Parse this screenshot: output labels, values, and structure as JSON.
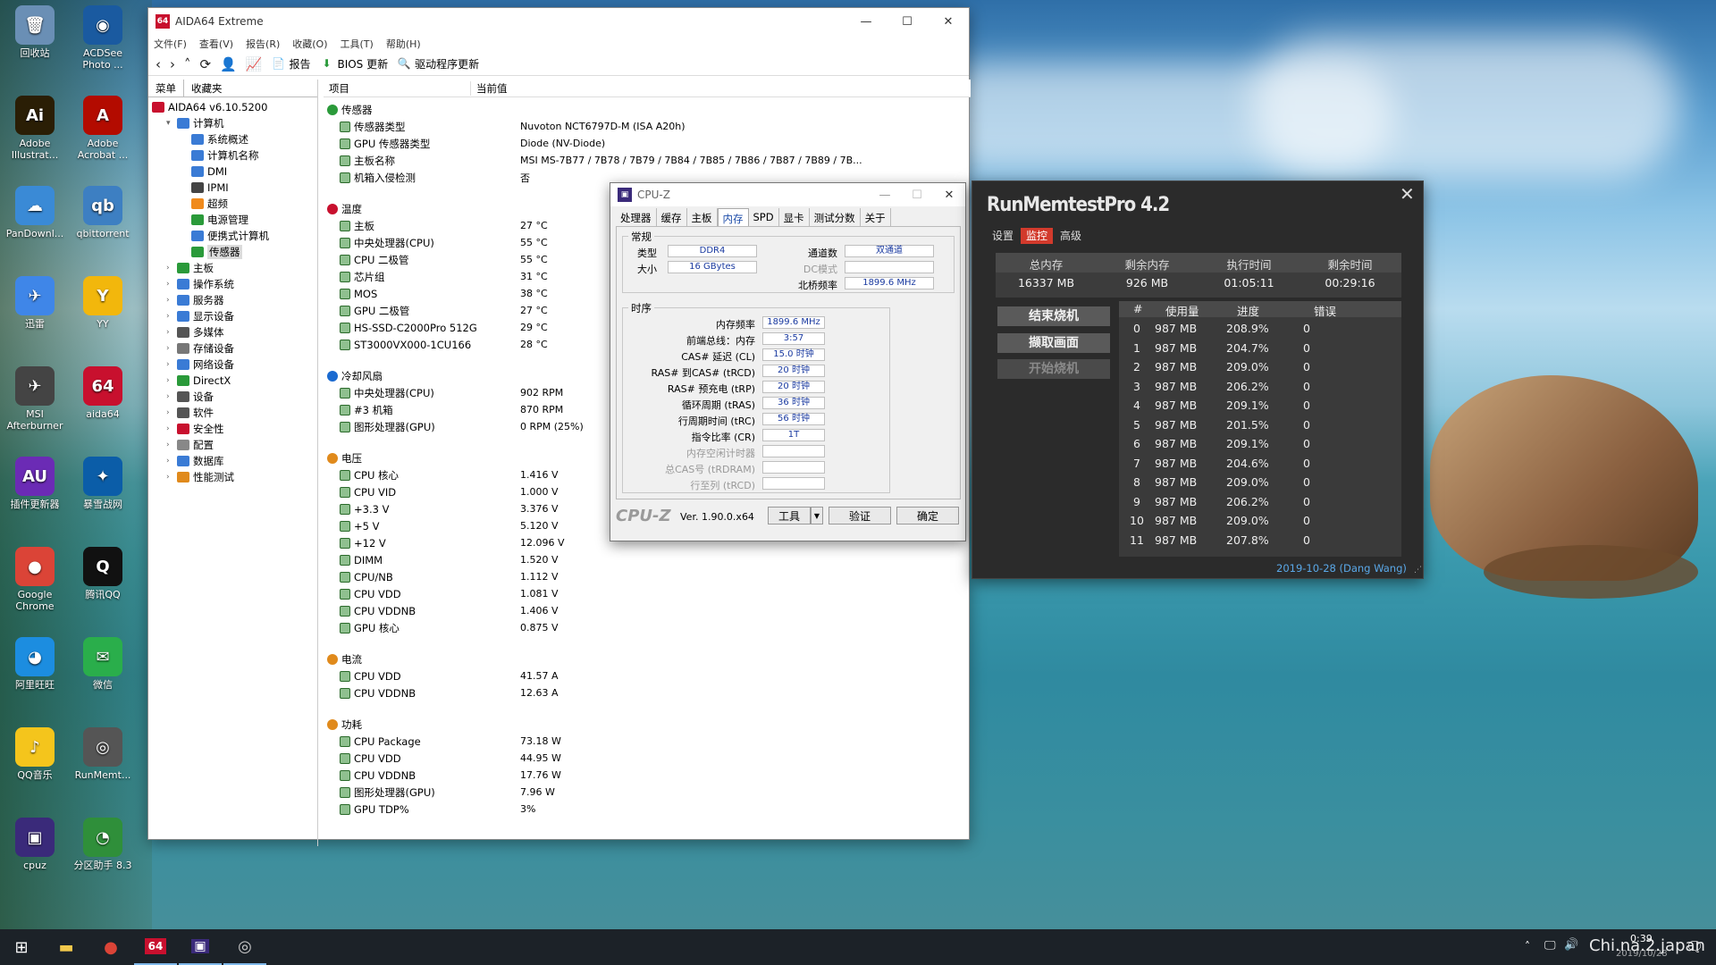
{
  "desktop": {
    "icons": [
      {
        "label": "回收站",
        "glyph": "🗑",
        "color": "#6a8fb5"
      },
      {
        "label": "ACDSee Photo ...",
        "glyph": "◉",
        "color": "#1a5aa0"
      },
      {
        "label": "Adobe Illustrat...",
        "glyph": "Ai",
        "color": "#2a1e05"
      },
      {
        "label": "Adobe Acrobat ...",
        "glyph": "A",
        "color": "#b30b00"
      },
      {
        "label": "PanDownl...",
        "glyph": "☁",
        "color": "#3a8ad6"
      },
      {
        "label": "qbittorrent",
        "glyph": "qb",
        "color": "#3d7fc2"
      },
      {
        "label": "迅雷",
        "glyph": "✈",
        "color": "#3f86e8"
      },
      {
        "label": "YY",
        "glyph": "Y",
        "color": "#f2b70c"
      },
      {
        "label": "MSI Afterburner",
        "glyph": "✈",
        "color": "#444"
      },
      {
        "label": "aida64",
        "glyph": "64",
        "color": "#c8102e"
      },
      {
        "label": "插件更新器",
        "glyph": "AU",
        "color": "#6b2bb5"
      },
      {
        "label": "暴雪战网",
        "glyph": "✦",
        "color": "#0b5da8"
      },
      {
        "label": "Google Chrome",
        "glyph": "●",
        "color": "#db4437"
      },
      {
        "label": "腾讯QQ",
        "glyph": "Q",
        "color": "#111"
      },
      {
        "label": "阿里旺旺",
        "glyph": "◕",
        "color": "#1c8de0"
      },
      {
        "label": "微信",
        "glyph": "✉",
        "color": "#2aae4b"
      },
      {
        "label": "QQ音乐",
        "glyph": "♪",
        "color": "#f4c51c"
      },
      {
        "label": "RunMemt...",
        "glyph": "◎",
        "color": "#555"
      },
      {
        "label": "cpuz",
        "glyph": "▣",
        "color": "#3a2a7a"
      },
      {
        "label": "分区助手 8.3",
        "glyph": "◔",
        "color": "#2f8f3a"
      }
    ]
  },
  "taskbar": {
    "clock_time": "0:39",
    "clock_date": "2019/10/28",
    "watermark": "Chi.na.2.japan"
  },
  "aida": {
    "title": "AIDA64 Extreme",
    "menus": [
      "文件(F)",
      "查看(V)",
      "报告(R)",
      "收藏(O)",
      "工具(T)",
      "帮助(H)"
    ],
    "toolbar": {
      "report": "报告",
      "bios": "BIOS 更新",
      "driver": "驱动程序更新"
    },
    "left_tabs": [
      "菜单",
      "收藏夹"
    ],
    "tree": [
      {
        "label": "AIDA64 v6.10.5200",
        "indent": 0,
        "color": "#c8102e"
      },
      {
        "label": "计算机",
        "indent": 1,
        "color": "#3a7bd5"
      },
      {
        "label": "系统概述",
        "indent": 2,
        "color": "#3a7bd5"
      },
      {
        "label": "计算机名称",
        "indent": 2,
        "color": "#3a7bd5"
      },
      {
        "label": "DMI",
        "indent": 2,
        "color": "#3a7bd5"
      },
      {
        "label": "IPMI",
        "indent": 2,
        "color": "#444"
      },
      {
        "label": "超频",
        "indent": 2,
        "color": "#f08a1c"
      },
      {
        "label": "电源管理",
        "indent": 2,
        "color": "#2a9a3a"
      },
      {
        "label": "便携式计算机",
        "indent": 2,
        "color": "#3a7bd5"
      },
      {
        "label": "传感器",
        "indent": 2,
        "color": "#2a9a3a",
        "selected": true
      },
      {
        "label": "主板",
        "indent": 1,
        "color": "#2a9a3a"
      },
      {
        "label": "操作系统",
        "indent": 1,
        "color": "#3a7bd5"
      },
      {
        "label": "服务器",
        "indent": 1,
        "color": "#3a7bd5"
      },
      {
        "label": "显示设备",
        "indent": 1,
        "color": "#3a7bd5"
      },
      {
        "label": "多媒体",
        "indent": 1,
        "color": "#555"
      },
      {
        "label": "存储设备",
        "indent": 1,
        "color": "#777"
      },
      {
        "label": "网络设备",
        "indent": 1,
        "color": "#3a7bd5"
      },
      {
        "label": "DirectX",
        "indent": 1,
        "color": "#2a9a3a"
      },
      {
        "label": "设备",
        "indent": 1,
        "color": "#555"
      },
      {
        "label": "软件",
        "indent": 1,
        "color": "#555"
      },
      {
        "label": "安全性",
        "indent": 1,
        "color": "#c8102e"
      },
      {
        "label": "配置",
        "indent": 1,
        "color": "#888"
      },
      {
        "label": "数据库",
        "indent": 1,
        "color": "#3a7bd5"
      },
      {
        "label": "性能测试",
        "indent": 1,
        "color": "#e08a1c"
      }
    ],
    "col_item": "项目",
    "col_value": "当前值",
    "sections": [
      {
        "title": "传感器",
        "rows": [
          {
            "k": "传感器类型",
            "v": "Nuvoton NCT6797D-M  (ISA A20h)"
          },
          {
            "k": "GPU 传感器类型",
            "v": "Diode  (NV-Diode)"
          },
          {
            "k": "主板名称",
            "v": "MSI MS-7B77 / 7B78 / 7B79 / 7B84 / 7B85 / 7B86 / 7B87 / 7B89 / 7B..."
          },
          {
            "k": "机箱入侵检测",
            "v": "否"
          }
        ]
      },
      {
        "title": "温度",
        "rows": [
          {
            "k": "主板",
            "v": "27 °C"
          },
          {
            "k": "中央处理器(CPU)",
            "v": "55 °C"
          },
          {
            "k": "CPU 二极管",
            "v": "55 °C"
          },
          {
            "k": "芯片组",
            "v": "31 °C"
          },
          {
            "k": "MOS",
            "v": "38 °C"
          },
          {
            "k": "GPU 二极管",
            "v": "27 °C"
          },
          {
            "k": "HS-SSD-C2000Pro 512G",
            "v": "29 °C"
          },
          {
            "k": "ST3000VX000-1CU166",
            "v": "28 °C"
          }
        ]
      },
      {
        "title": "冷却风扇",
        "rows": [
          {
            "k": "中央处理器(CPU)",
            "v": "902 RPM"
          },
          {
            "k": "#3 机箱",
            "v": "870 RPM"
          },
          {
            "k": "图形处理器(GPU)",
            "v": "0 RPM  (25%)"
          }
        ]
      },
      {
        "title": "电压",
        "rows": [
          {
            "k": "CPU 核心",
            "v": "1.416 V"
          },
          {
            "k": "CPU VID",
            "v": "1.000 V"
          },
          {
            "k": "+3.3 V",
            "v": "3.376 V"
          },
          {
            "k": "+5 V",
            "v": "5.120 V"
          },
          {
            "k": "+12 V",
            "v": "12.096 V"
          },
          {
            "k": "DIMM",
            "v": "1.520 V"
          },
          {
            "k": "CPU/NB",
            "v": "1.112 V"
          },
          {
            "k": "CPU VDD",
            "v": "1.081 V"
          },
          {
            "k": "CPU VDDNB",
            "v": "1.406 V"
          },
          {
            "k": "GPU 核心",
            "v": "0.875 V"
          }
        ]
      },
      {
        "title": "电流",
        "rows": [
          {
            "k": "CPU VDD",
            "v": "41.57 A"
          },
          {
            "k": "CPU VDDNB",
            "v": "12.63 A"
          }
        ]
      },
      {
        "title": "功耗",
        "rows": [
          {
            "k": "CPU Package",
            "v": "73.18 W"
          },
          {
            "k": "CPU VDD",
            "v": "44.95 W"
          },
          {
            "k": "CPU VDDNB",
            "v": "17.76 W"
          },
          {
            "k": "图形处理器(GPU)",
            "v": "7.96 W"
          },
          {
            "k": "GPU TDP%",
            "v": "3%"
          }
        ]
      }
    ]
  },
  "cpuz": {
    "title": "CPU-Z",
    "tabs": [
      "处理器",
      "缓存",
      "主板",
      "内存",
      "SPD",
      "显卡",
      "测试分数",
      "关于"
    ],
    "general_title": "常规",
    "type_label": "类型",
    "type_value": "DDR4",
    "size_label": "大小",
    "size_value": "16 GBytes",
    "channels_label": "通道数",
    "channels_value": "双通道",
    "dc_label": "DC模式",
    "dc_value": "",
    "nb_label": "北桥频率",
    "nb_value": "1899.6 MHz",
    "timing_title": "时序",
    "timings": [
      {
        "label": "内存频率",
        "value": "1899.6 MHz"
      },
      {
        "label": "前端总线：内存",
        "value": "3:57"
      },
      {
        "label": "CAS# 延迟 (CL)",
        "value": "15.0 时钟"
      },
      {
        "label": "RAS# 到CAS# (tRCD)",
        "value": "20 时钟"
      },
      {
        "label": "RAS# 预充电 (tRP)",
        "value": "20 时钟"
      },
      {
        "label": "循环周期 (tRAS)",
        "value": "36 时钟"
      },
      {
        "label": "行周期时间 (tRC)",
        "value": "56 时钟"
      },
      {
        "label": "指令比率 (CR)",
        "value": "1T"
      },
      {
        "label": "内存空闲计时器",
        "value": ""
      },
      {
        "label": "总CAS号 (tRDRAM)",
        "value": ""
      },
      {
        "label": "行至列 (tRCD)",
        "value": ""
      }
    ],
    "logo": "CPU-Z",
    "version": "Ver. 1.90.0.x64",
    "tools_btn": "工具",
    "validate_btn": "验证",
    "ok_btn": "确定"
  },
  "runmemtest": {
    "title": "RunMemtestPro 4.2",
    "tabs": [
      "设置",
      "监控",
      "高级"
    ],
    "stat_headers": [
      "总内存",
      "剩余内存",
      "执行时间",
      "剩余时间"
    ],
    "stat_values": [
      "16337 MB",
      "926 MB",
      "01:05:11",
      "00:29:16"
    ],
    "buttons": [
      "结束烧机",
      "撷取画面",
      "开始烧机"
    ],
    "table_headers": [
      "#",
      "使用量",
      "进度",
      "错误"
    ],
    "rows": [
      [
        "0",
        "987 MB",
        "208.9%",
        "0"
      ],
      [
        "1",
        "987 MB",
        "204.7%",
        "0"
      ],
      [
        "2",
        "987 MB",
        "209.0%",
        "0"
      ],
      [
        "3",
        "987 MB",
        "206.2%",
        "0"
      ],
      [
        "4",
        "987 MB",
        "209.1%",
        "0"
      ],
      [
        "5",
        "987 MB",
        "201.5%",
        "0"
      ],
      [
        "6",
        "987 MB",
        "209.1%",
        "0"
      ],
      [
        "7",
        "987 MB",
        "204.6%",
        "0"
      ],
      [
        "8",
        "987 MB",
        "209.0%",
        "0"
      ],
      [
        "9",
        "987 MB",
        "206.2%",
        "0"
      ],
      [
        "10",
        "987 MB",
        "209.0%",
        "0"
      ],
      [
        "11",
        "987 MB",
        "207.8%",
        "0"
      ]
    ],
    "footer": "2019-10-28 (Dang Wang)"
  }
}
